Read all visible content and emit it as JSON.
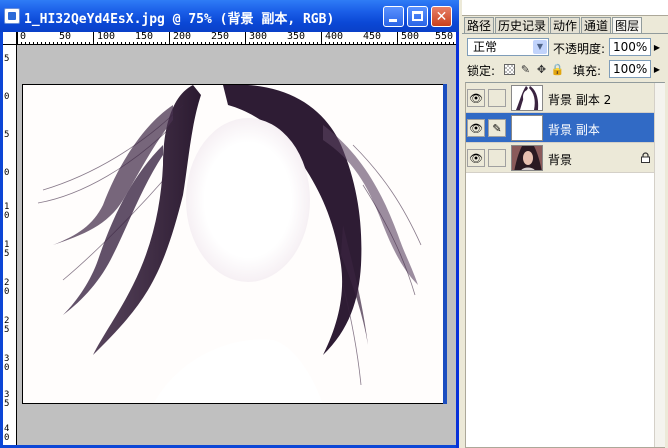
{
  "document": {
    "title": "1_HI32QeYd4EsX.jpg @ 75% (背景 副本, RGB)",
    "ruler_h_labels": [
      "0",
      "50",
      "100",
      "150",
      "200",
      "250",
      "300",
      "350",
      "400",
      "450",
      "500",
      "550"
    ],
    "ruler_v_labels": [
      "5",
      "0",
      "5",
      "0",
      "1 0",
      "1 5",
      "2 0",
      "2 5",
      "3 0",
      "3 5",
      "4 0"
    ]
  },
  "panel": {
    "tabs": [
      "路径",
      "历史记录",
      "动作",
      "通道",
      "图层"
    ],
    "active_tab": "图层",
    "blend_mode": "正常",
    "opacity_label": "不透明度:",
    "opacity_value": "100%",
    "lock_label": "锁定:",
    "fill_label": "填充:",
    "fill_value": "100%",
    "layers": [
      {
        "name": "背景 副本 2",
        "selected": false,
        "locked": false
      },
      {
        "name": "背景 副本",
        "selected": true,
        "locked": false
      },
      {
        "name": "背景",
        "selected": false,
        "locked": true
      }
    ]
  },
  "colors": {
    "title_blue": "#0b48d6",
    "selection": "#316ac5",
    "hair": "#3a2440"
  }
}
